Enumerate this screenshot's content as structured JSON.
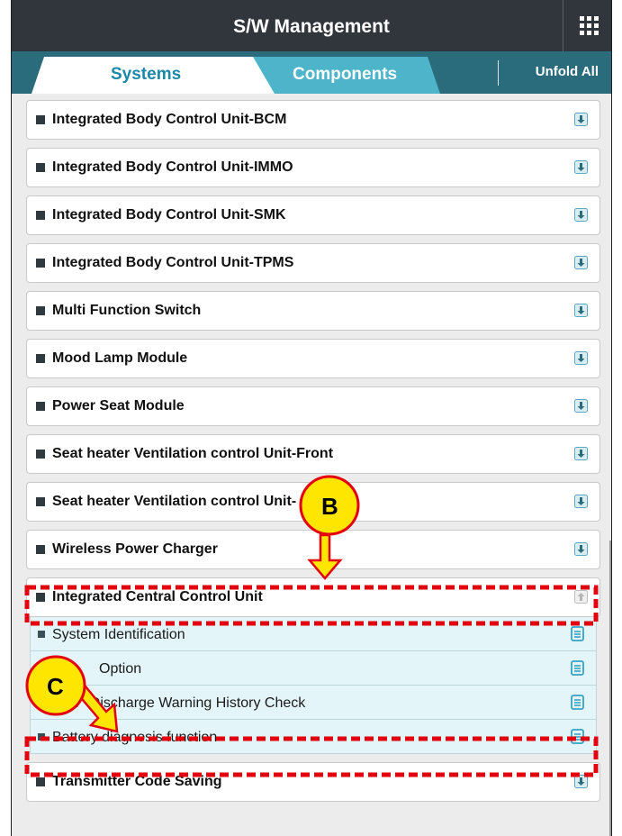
{
  "header": {
    "title": "S/W Management",
    "menu_icon": "grid-icon"
  },
  "tabs": {
    "systems": "Systems",
    "components": "Components",
    "unfold_all": "Unfold All"
  },
  "list": {
    "items": [
      "Integrated Body Control Unit-BCM",
      "Integrated Body Control Unit-IMMO",
      "Integrated Body Control Unit-SMK",
      "Integrated Body Control Unit-TPMS",
      "Multi Function Switch",
      "Mood Lamp Module",
      "Power Seat Module",
      "Seat heater Ventilation control Unit-Front",
      "Seat heater Ventilation control Unit-",
      "Wireless Power Charger"
    ],
    "expanded": {
      "label": "Integrated Central Control Unit",
      "subitems": [
        "System Identification",
        "Option",
        "Batt   Discharge Warning History Check",
        "Battery diagnosis function"
      ]
    },
    "last": "Transmitter Code Saving"
  },
  "callouts": {
    "b": "B",
    "c": "C"
  },
  "colors": {
    "header": "#30363c",
    "tab_active_text": "#1a88a8",
    "tab_bar": "#2a6b7c",
    "highlight": "#e3000f",
    "badge": "#ffe600"
  }
}
